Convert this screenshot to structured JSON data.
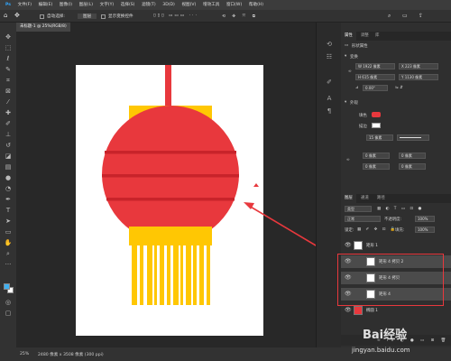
{
  "menu": [
    "文件(F)",
    "编辑(E)",
    "图像(I)",
    "图层(L)",
    "文字(Y)",
    "选择(S)",
    "滤镜(T)",
    "3D(D)",
    "视图(V)",
    "增效工具",
    "窗口(W)",
    "帮助(H)"
  ],
  "options_bar": {
    "auto_select_label": "自动选择:",
    "auto_select_value": "图层",
    "transform_label": "显示变换控件"
  },
  "document_tab": "未标题-1 @ 25%(RGB/8)",
  "status": {
    "zoom": "25%",
    "doc_info": "2480 像素 x 3508 像素 (300 ppi)"
  },
  "properties_panel": {
    "tabs": [
      "属性",
      "调整",
      "库"
    ],
    "type_label": "形状属性",
    "transform_heading": "变换",
    "w": "W  1922 像素",
    "x": "X  223 像素",
    "h": "H  615 像素",
    "y": "Y  1130 像素",
    "angle": "0.00°",
    "appearance_heading": "外观",
    "fill_label": "填色",
    "stroke_label": "描边",
    "stroke_size": "15 像素",
    "corner_radius_1": "0 像素",
    "corner_radius_2": "0 像素",
    "corner_radius_3": "0 像素",
    "corner_radius_4": "0 像素",
    "fill_color": "#e8383d"
  },
  "layers_panel": {
    "tabs": [
      "图层",
      "通道",
      "路径"
    ],
    "filter_label": "类型",
    "blend_mode": "正常",
    "opacity_label": "不透明度:",
    "opacity_value": "100%",
    "lock_label": "锁定:",
    "fill_label": "填充:",
    "fill_value": "100%",
    "layers": [
      {
        "name": "矩形 1",
        "child": false,
        "selected": false
      },
      {
        "name": "矩形 4 拷贝 2",
        "child": true,
        "selected": true
      },
      {
        "name": "矩形 4 拷贝",
        "child": true,
        "selected": true
      },
      {
        "name": "矩形 4",
        "child": true,
        "selected": true
      },
      {
        "name": "椭圆 1",
        "child": false,
        "selected": false
      }
    ]
  },
  "lantern_colors": {
    "red": "#e8383d",
    "stripe": "#c8232a",
    "gold": "#ffc703",
    "gold_light": "#ffd84a",
    "arrow": "#e8383d"
  },
  "watermark": {
    "site": "Bai经验",
    "url": "jingyan.baidu.com"
  }
}
